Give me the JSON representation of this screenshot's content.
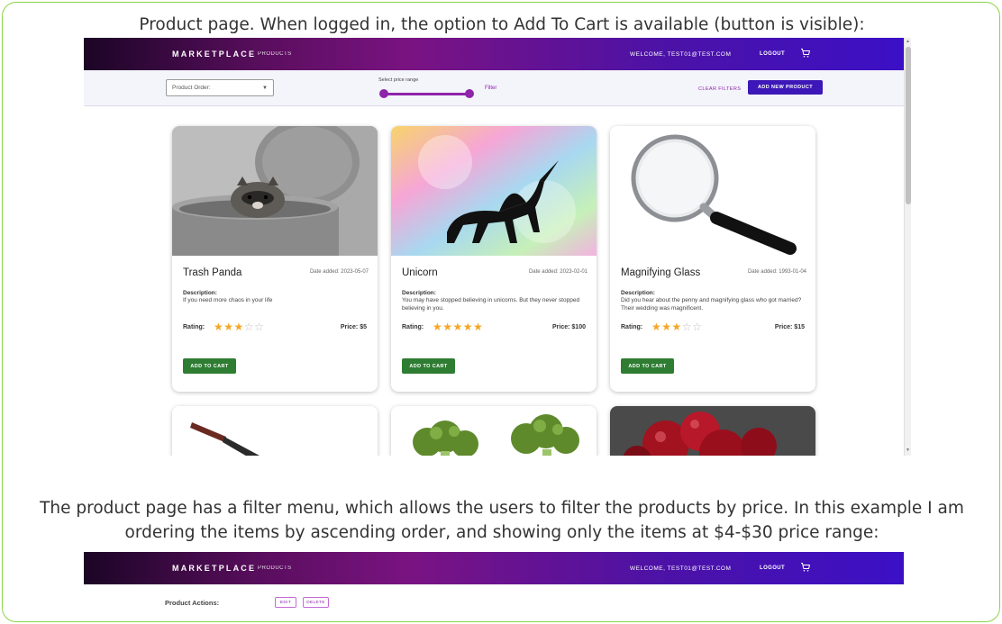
{
  "captions": {
    "top": "Product page. When logged in, the option to Add To Cart is available (button is visible):",
    "middle_line1": "The product page has a filter menu, which allows the users to filter the products by price. In this example I am",
    "middle_line2": "ordering the items by ascending order, and showing only the items at $4-$30 price range:"
  },
  "navbar": {
    "brand": "MARKETPLACE",
    "products_link": "PRODUCTS",
    "welcome": "WELCOME, TEST01@TEST.COM",
    "logout": "LOGOUT",
    "cart_icon": "cart-icon"
  },
  "filters": {
    "product_order_placeholder": "Product Order:",
    "price_range_label": "Select price range",
    "price_range_min_fraction": 0.0,
    "price_range_max_fraction": 1.0,
    "filter_link": "Filter",
    "clear_filters": "CLEAR FILTERS",
    "add_new_product": "ADD NEW PRODUCT"
  },
  "products": [
    {
      "title": "Trash Panda",
      "date": "Date added: 2023-05-07",
      "description_label": "Description:",
      "description": "If you need more chaos in your life",
      "rating_label": "Rating:",
      "rating": 3,
      "rating_max": 5,
      "price": "Price: $5",
      "cart_button": "ADD TO CART"
    },
    {
      "title": "Unicorn",
      "date": "Date added: 2023-02-01",
      "description_label": "Description:",
      "description": "You may have stopped believing in unicorns. But they never stopped believing in you.",
      "rating_label": "Rating:",
      "rating": 5,
      "rating_max": 5,
      "price": "Price: $100",
      "cart_button": "ADD TO CART"
    },
    {
      "title": "Magnifying Glass",
      "date": "Date added: 1993-01-04",
      "description_label": "Description:",
      "description": "Did you hear about the penny and magnifying glass who got married? Their wedding was magnificent.",
      "rating_label": "Rating:",
      "rating": 3,
      "rating_max": 5,
      "price": "Price: $15",
      "cart_button": "ADD TO CART"
    }
  ],
  "second_screen": {
    "product_actions_label": "Product Actions:",
    "edit_button": "EDIT",
    "delete_button": "DELETE"
  },
  "colors": {
    "accent": "#8e24aa",
    "primary_button": "#3d17b8",
    "cart_button": "#2e7d32",
    "star": "#f5a623",
    "frame_border": "#8bd34a"
  }
}
